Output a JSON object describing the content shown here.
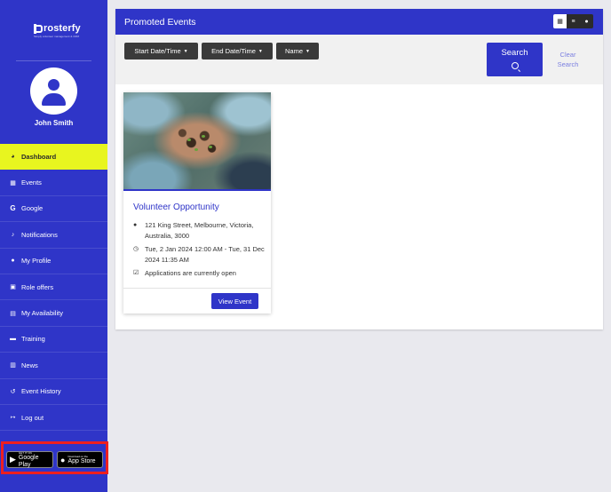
{
  "app": {
    "logo_text": "rosterfy",
    "logo_tagline": "Simply volunteer management & CRM"
  },
  "user": {
    "name": "John Smith"
  },
  "sidebar": {
    "items": [
      {
        "label": "Dashboard",
        "icon": "gauge-icon",
        "active": true
      },
      {
        "label": "Events",
        "icon": "calendar-icon"
      },
      {
        "label": "Google",
        "icon": "google-icon"
      },
      {
        "label": "Notifications",
        "icon": "bell-icon"
      },
      {
        "label": "My Profile",
        "icon": "user-icon"
      },
      {
        "label": "Role offers",
        "icon": "briefcase-icon"
      },
      {
        "label": "My Availability",
        "icon": "calendar-check-icon"
      },
      {
        "label": "Training",
        "icon": "training-icon"
      },
      {
        "label": "News",
        "icon": "newspaper-icon"
      },
      {
        "label": "Event History",
        "icon": "history-icon"
      },
      {
        "label": "Log out",
        "icon": "logout-icon"
      }
    ],
    "stores": {
      "google_small": "GET IT ON",
      "google_big": "Google Play",
      "apple_small": "Download on the",
      "apple_big": "App Store"
    }
  },
  "main": {
    "title": "Promoted Events",
    "view_modes": [
      "grid-view-icon",
      "list-view-icon",
      "map-view-icon"
    ],
    "filters": {
      "start": "Start Date/Time",
      "end": "End Date/Time",
      "name": "Name",
      "search": "Search",
      "clear_line1": "Clear",
      "clear_line2": "Search"
    },
    "events": [
      {
        "title": "Volunteer Opportunity",
        "address": "121 King Street, Melbourne, Victoria, Australia, 3000",
        "datetime": "Tue, 2 Jan 2024 12:00 AM - Tue, 31 Dec 2024 11:35 AM",
        "status": "Applications are currently open",
        "button": "View Event"
      }
    ]
  },
  "colors": {
    "brand": "#2f35c8",
    "active_nav": "#e8f51f",
    "highlight_box": "#ee1f1f"
  }
}
